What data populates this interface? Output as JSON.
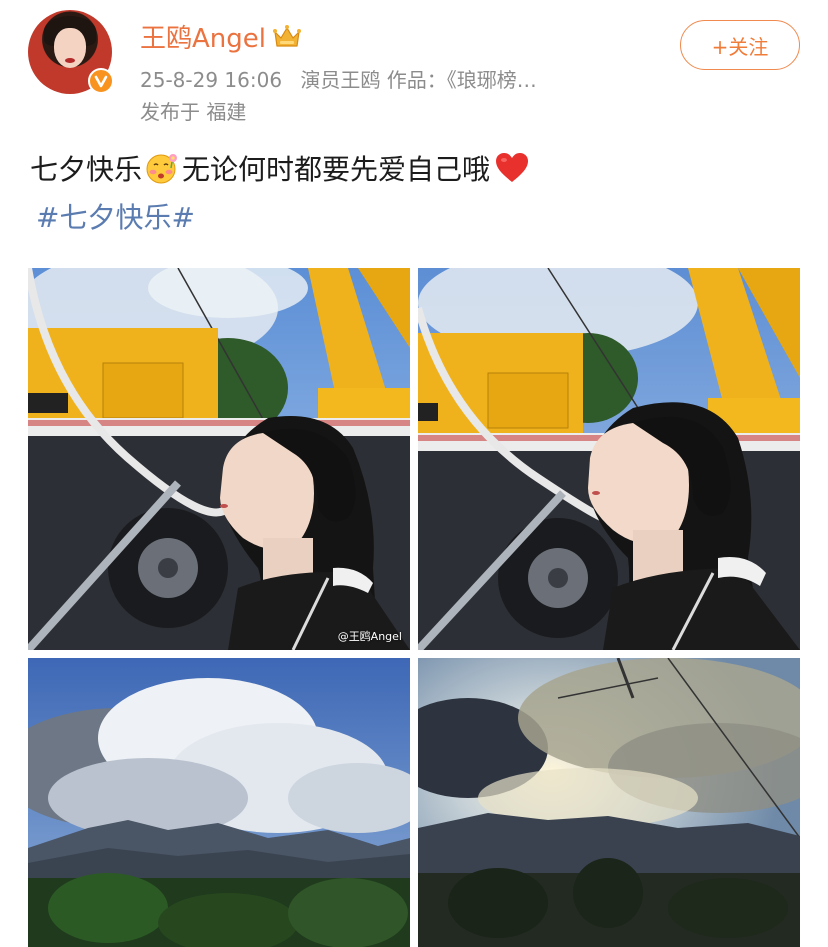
{
  "header": {
    "username": "王鸥Angel",
    "timestamp": "25-8-29 16:06",
    "source": "演员王鸥 作品：《琅琊榜…",
    "location": "发布于 福建",
    "follow_label": "+关注",
    "avatar_icon": "avatar",
    "verified_icon": "verified-v-icon",
    "member_icon": "crown-icon"
  },
  "post": {
    "text_part1": "七夕快乐",
    "text_part2": "无论何时都要先爱自己哦",
    "emoji_icon": "blushing-flower-emoji-icon",
    "heart_icon": "red-heart-icon",
    "hashtag": "#七夕快乐#"
  },
  "photos": {
    "watermark": "@王鸥Angel",
    "items": [
      {
        "name": "selfie-crane-1"
      },
      {
        "name": "selfie-crane-2"
      },
      {
        "name": "sky-mountains"
      },
      {
        "name": "sunlit-clouds"
      }
    ]
  },
  "colors": {
    "username": "#eb7340",
    "follow": "#f07c3a",
    "hashtag": "#5b7cb0",
    "meta": "#8c8c8c",
    "verified": "#f7931e"
  }
}
